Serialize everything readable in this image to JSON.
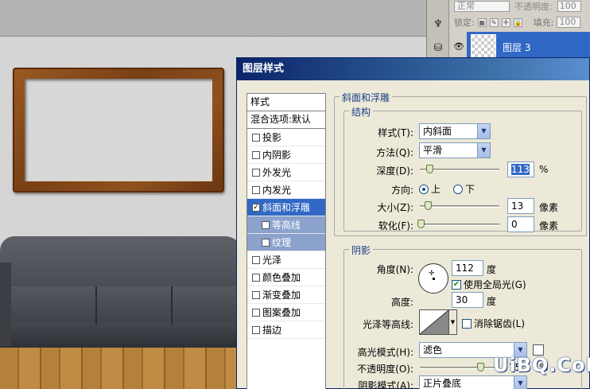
{
  "layers_panel": {
    "blend_mode": "正常",
    "opacity_label": "不透明度:",
    "opacity_value": "100",
    "lock_label": "锁定:",
    "fill_label": "填充:",
    "fill_value": "100",
    "layer_name": "图层 3"
  },
  "dialog": {
    "title": "图层样式",
    "styles_header": "样式",
    "blend_options": "混合选项:默认",
    "items": [
      {
        "label": "投影",
        "checked": false
      },
      {
        "label": "内阴影",
        "checked": false
      },
      {
        "label": "外发光",
        "checked": false
      },
      {
        "label": "内发光",
        "checked": false
      },
      {
        "label": "斜面和浮雕",
        "checked": true
      },
      {
        "label": "等高线",
        "checked": false
      },
      {
        "label": "纹理",
        "checked": false
      },
      {
        "label": "光泽",
        "checked": false
      },
      {
        "label": "颜色叠加",
        "checked": false
      },
      {
        "label": "渐变叠加",
        "checked": false
      },
      {
        "label": "图案叠加",
        "checked": false
      },
      {
        "label": "描边",
        "checked": false
      }
    ],
    "bevel_section": "斜面和浮雕",
    "structure": {
      "title": "结构",
      "style_label": "样式(T):",
      "style_value": "内斜面",
      "technique_label": "方法(Q):",
      "technique_value": "平滑",
      "depth_label": "深度(D):",
      "depth_value": "113",
      "depth_unit": "%",
      "direction_label": "方向:",
      "direction_up": "上",
      "direction_down": "下",
      "size_label": "大小(Z):",
      "size_value": "13",
      "size_unit": "像素",
      "soften_label": "软化(F):",
      "soften_value": "0",
      "soften_unit": "像素"
    },
    "shading": {
      "title": "阴影",
      "angle_label": "角度(N):",
      "angle_value": "112",
      "angle_unit": "度",
      "global_light": "使用全局光(G)",
      "altitude_label": "高度:",
      "altitude_value": "30",
      "altitude_unit": "度",
      "gloss_label": "光泽等高线:",
      "antialias": "消除锯齿(L)",
      "highlight_label": "高光模式(H):",
      "highlight_value": "滤色",
      "opacity_label": "不透明度(O):",
      "opacity_value": "75",
      "opacity_unit": "%",
      "shadow_label": "阴影模式(A):",
      "shadow_value": "正片叠底"
    }
  },
  "watermark": "UiBQ.CoM"
}
